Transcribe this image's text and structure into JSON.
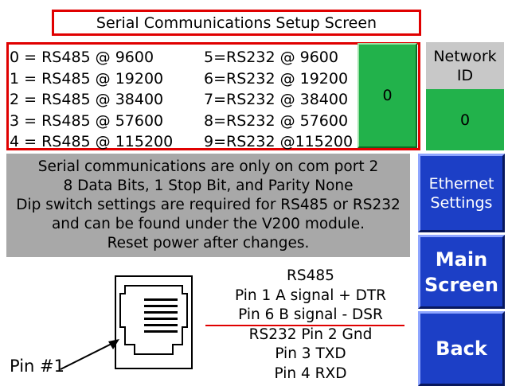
{
  "title": "Serial Communications Setup Screen",
  "baud_options_left": [
    "0 = RS485 @ 9600",
    "1 = RS485 @ 19200",
    "2 = RS485 @ 38400",
    "3 = RS485 @ 57600",
    "4 = RS485 @ 115200"
  ],
  "baud_options_right": [
    "5=RS232 @ 9600",
    "6=RS232 @ 19200",
    "7=RS232 @ 38400",
    "8=RS232 @ 57600",
    "9=RS232 @115200"
  ],
  "baud_value": "0",
  "network_id": {
    "label_line1": "Network",
    "label_line2": "ID",
    "value": "0"
  },
  "info_lines": [
    "Serial communications are only on com port 2",
    "8 Data Bits, 1 Stop Bit, and Parity None",
    "Dip switch settings are required for RS485 or RS232",
    "and can be found under the V200 module.",
    "Reset power after changes."
  ],
  "buttons": {
    "ethernet_line1": "Ethernet",
    "ethernet_line2": "Settings",
    "main_line1": "Main",
    "main_line2": "Screen",
    "back": "Back"
  },
  "pinout": [
    "RS485",
    "Pin 1 A signal + DTR",
    "Pin 6 B signal  - DSR",
    "RS232 Pin 2 Gnd",
    "Pin 3 TXD",
    "Pin 4 RXD"
  ],
  "pin_label": "Pin #1",
  "colors": {
    "red_border": "#e00000",
    "green": "#22b24b",
    "blue_button": "#1c3fc6",
    "gray_panel": "#a8a8a8",
    "gray_label": "#c8c8c8"
  }
}
